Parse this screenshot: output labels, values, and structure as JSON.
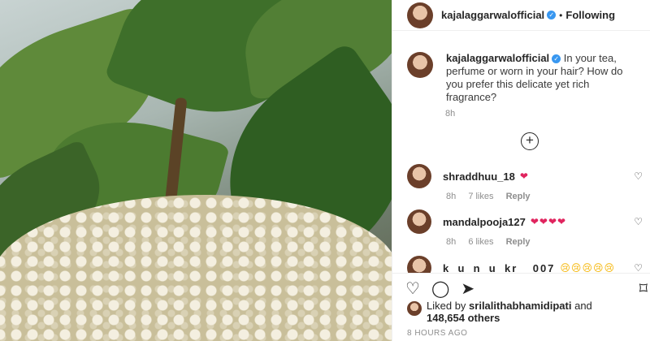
{
  "post": {
    "username": "kajalaggarwalofficial",
    "follow_label": "Following",
    "dot": "•",
    "caption": "In your tea, perfume or worn in your hair? How do you prefer this delicate yet rich fragrance?",
    "caption_time": "8h",
    "load_more": "+"
  },
  "comments": [
    {
      "username": "shraddhuu_18",
      "emoji": "❤",
      "time": "8h",
      "likes": "7 likes",
      "reply": "Reply"
    },
    {
      "username": "mandalpooja127",
      "emoji": "❤❤❤❤",
      "time": "8h",
      "likes": "6 likes",
      "reply": "Reply"
    },
    {
      "username": "k_u_n_u_kr__007",
      "emoji": "😢😢😢😢😢"
    }
  ],
  "footer": {
    "liked_prefix": "Liked by",
    "liked_user": "srilalithabhamidipati",
    "liked_and": "and",
    "likes_count": "148,654 others",
    "posted": "8 HOURS AGO"
  },
  "icons": {
    "like": "♡",
    "comment": "◯",
    "share": "➤",
    "save": "⌑",
    "verified": "✓",
    "comment_like": "♡"
  }
}
